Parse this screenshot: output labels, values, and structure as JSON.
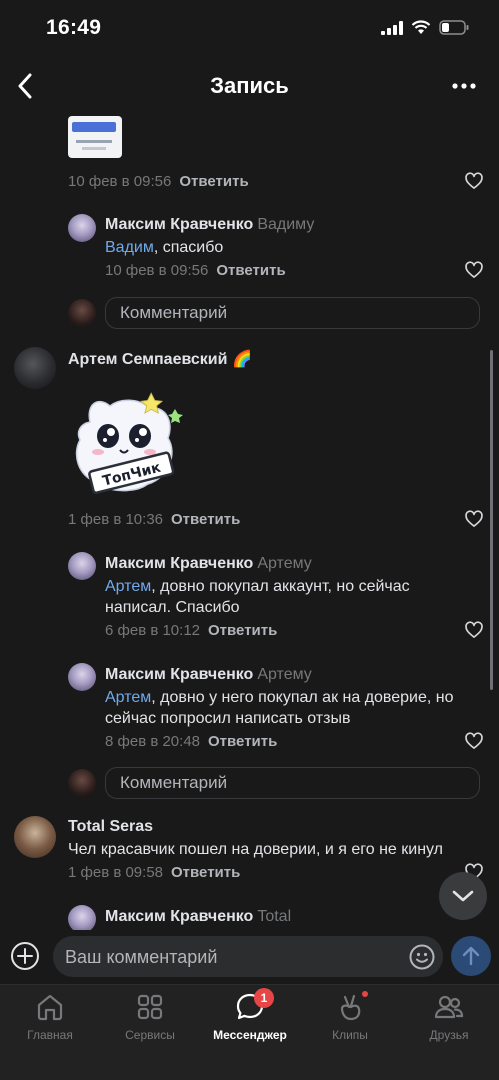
{
  "status": {
    "time": "16:49"
  },
  "nav": {
    "title": "Запись"
  },
  "comments": [
    {
      "date": "10 фев в 09:56",
      "reply": "Ответить"
    },
    {
      "author": "Максим Кравченко",
      "to": "Вадиму",
      "mention": "Вадим",
      "text": ", спасибо",
      "date": "10 фев в 09:56",
      "reply": "Ответить"
    },
    {
      "author": "Артем Семпаевский",
      "author_emoji": "🌈",
      "sticker_text": "ТопЧик",
      "date": "1 фев в 10:36",
      "reply": "Ответить"
    },
    {
      "author": "Максим Кравченко",
      "to": "Артему",
      "mention": "Артем",
      "text_line1": ", довно покупал аккаунт, но сейчас",
      "text_line2": "написал. Спасибо",
      "date": "6 фев в 10:12",
      "reply": "Ответить"
    },
    {
      "author": "Максим Кравченко",
      "to": "Артему",
      "mention": "Артем",
      "text_line1": ", довно у него покупал ак на доверие, но",
      "text_line2": "сейчас попросил написать отзыв",
      "date": "8 фев в 20:48",
      "reply": "Ответить"
    },
    {
      "author": "Total Seras",
      "text": "Чел красавчик пошел на доверии, и я его не кинул",
      "date": "1 фев в 09:58",
      "reply": "Ответить"
    },
    {
      "author": "Максим Кравченко",
      "to": "Total"
    }
  ],
  "comment_box": {
    "placeholder": "Комментарий"
  },
  "composer": {
    "placeholder": "Ваш комментарий"
  },
  "tabs": [
    {
      "label": "Главная",
      "icon": "home-icon"
    },
    {
      "label": "Сервисы",
      "icon": "services-icon"
    },
    {
      "label": "Мессенджер",
      "icon": "messenger-icon",
      "badge": "1",
      "active": true
    },
    {
      "label": "Клипы",
      "icon": "clips-icon"
    },
    {
      "label": "Друзья",
      "icon": "friends-icon"
    }
  ],
  "colors": {
    "background": "#19191a",
    "accent": "#71aaeb",
    "badge": "#e64646",
    "muted": "#76787a"
  }
}
